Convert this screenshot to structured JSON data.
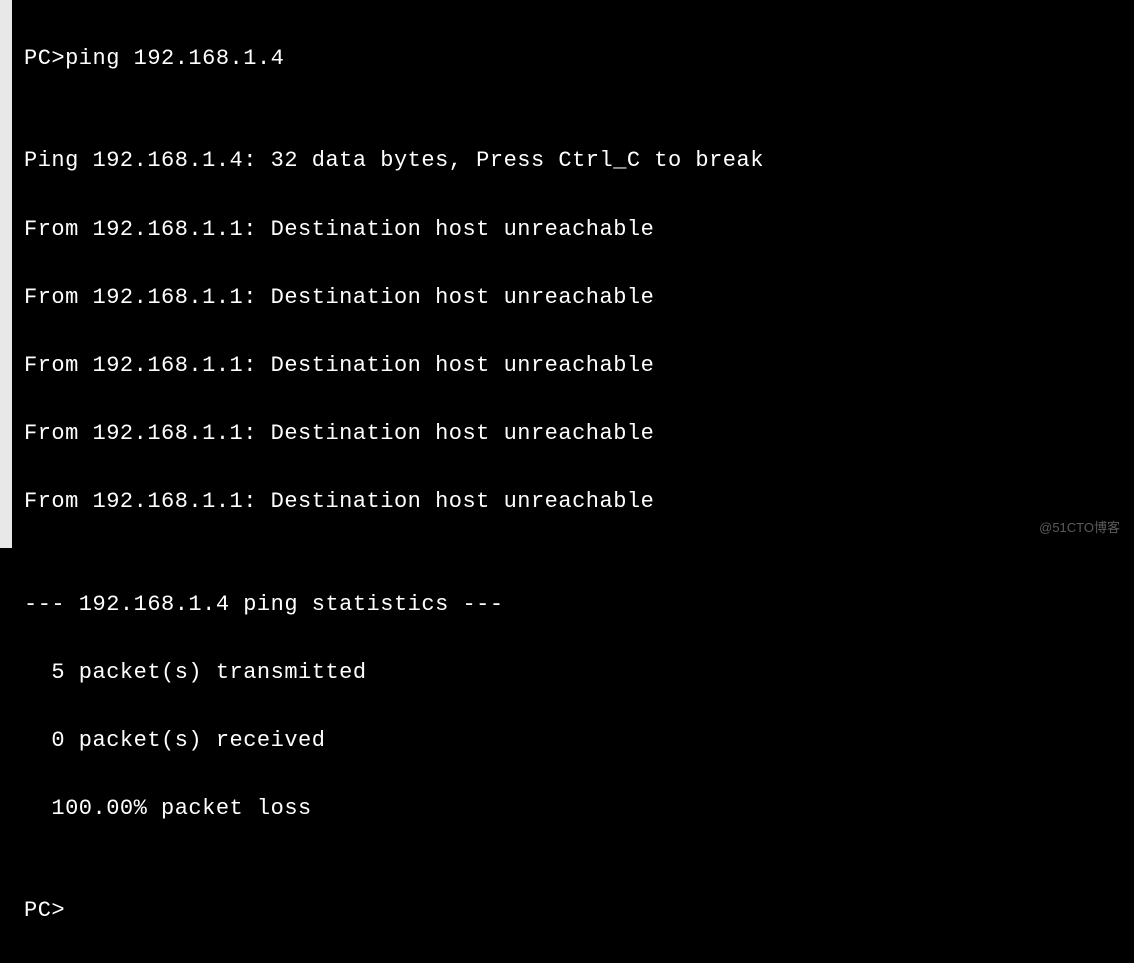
{
  "terminal": {
    "prompt": "PC>",
    "command": "ping 192.168.1.4",
    "blank": "",
    "header": "Ping 192.168.1.4: 32 data bytes, Press Ctrl_C to break",
    "replies": [
      "From 192.168.1.1: Destination host unreachable",
      "From 192.168.1.1: Destination host unreachable",
      "From 192.168.1.1: Destination host unreachable",
      "From 192.168.1.1: Destination host unreachable",
      "From 192.168.1.1: Destination host unreachable"
    ],
    "stats_header": "--- 192.168.1.4 ping statistics ---",
    "stats_tx": "  5 packet(s) transmitted",
    "stats_rx": "  0 packet(s) received",
    "stats_loss": "  100.00% packet loss",
    "prompt2": "PC>"
  },
  "watermark": "@51CTO博客"
}
